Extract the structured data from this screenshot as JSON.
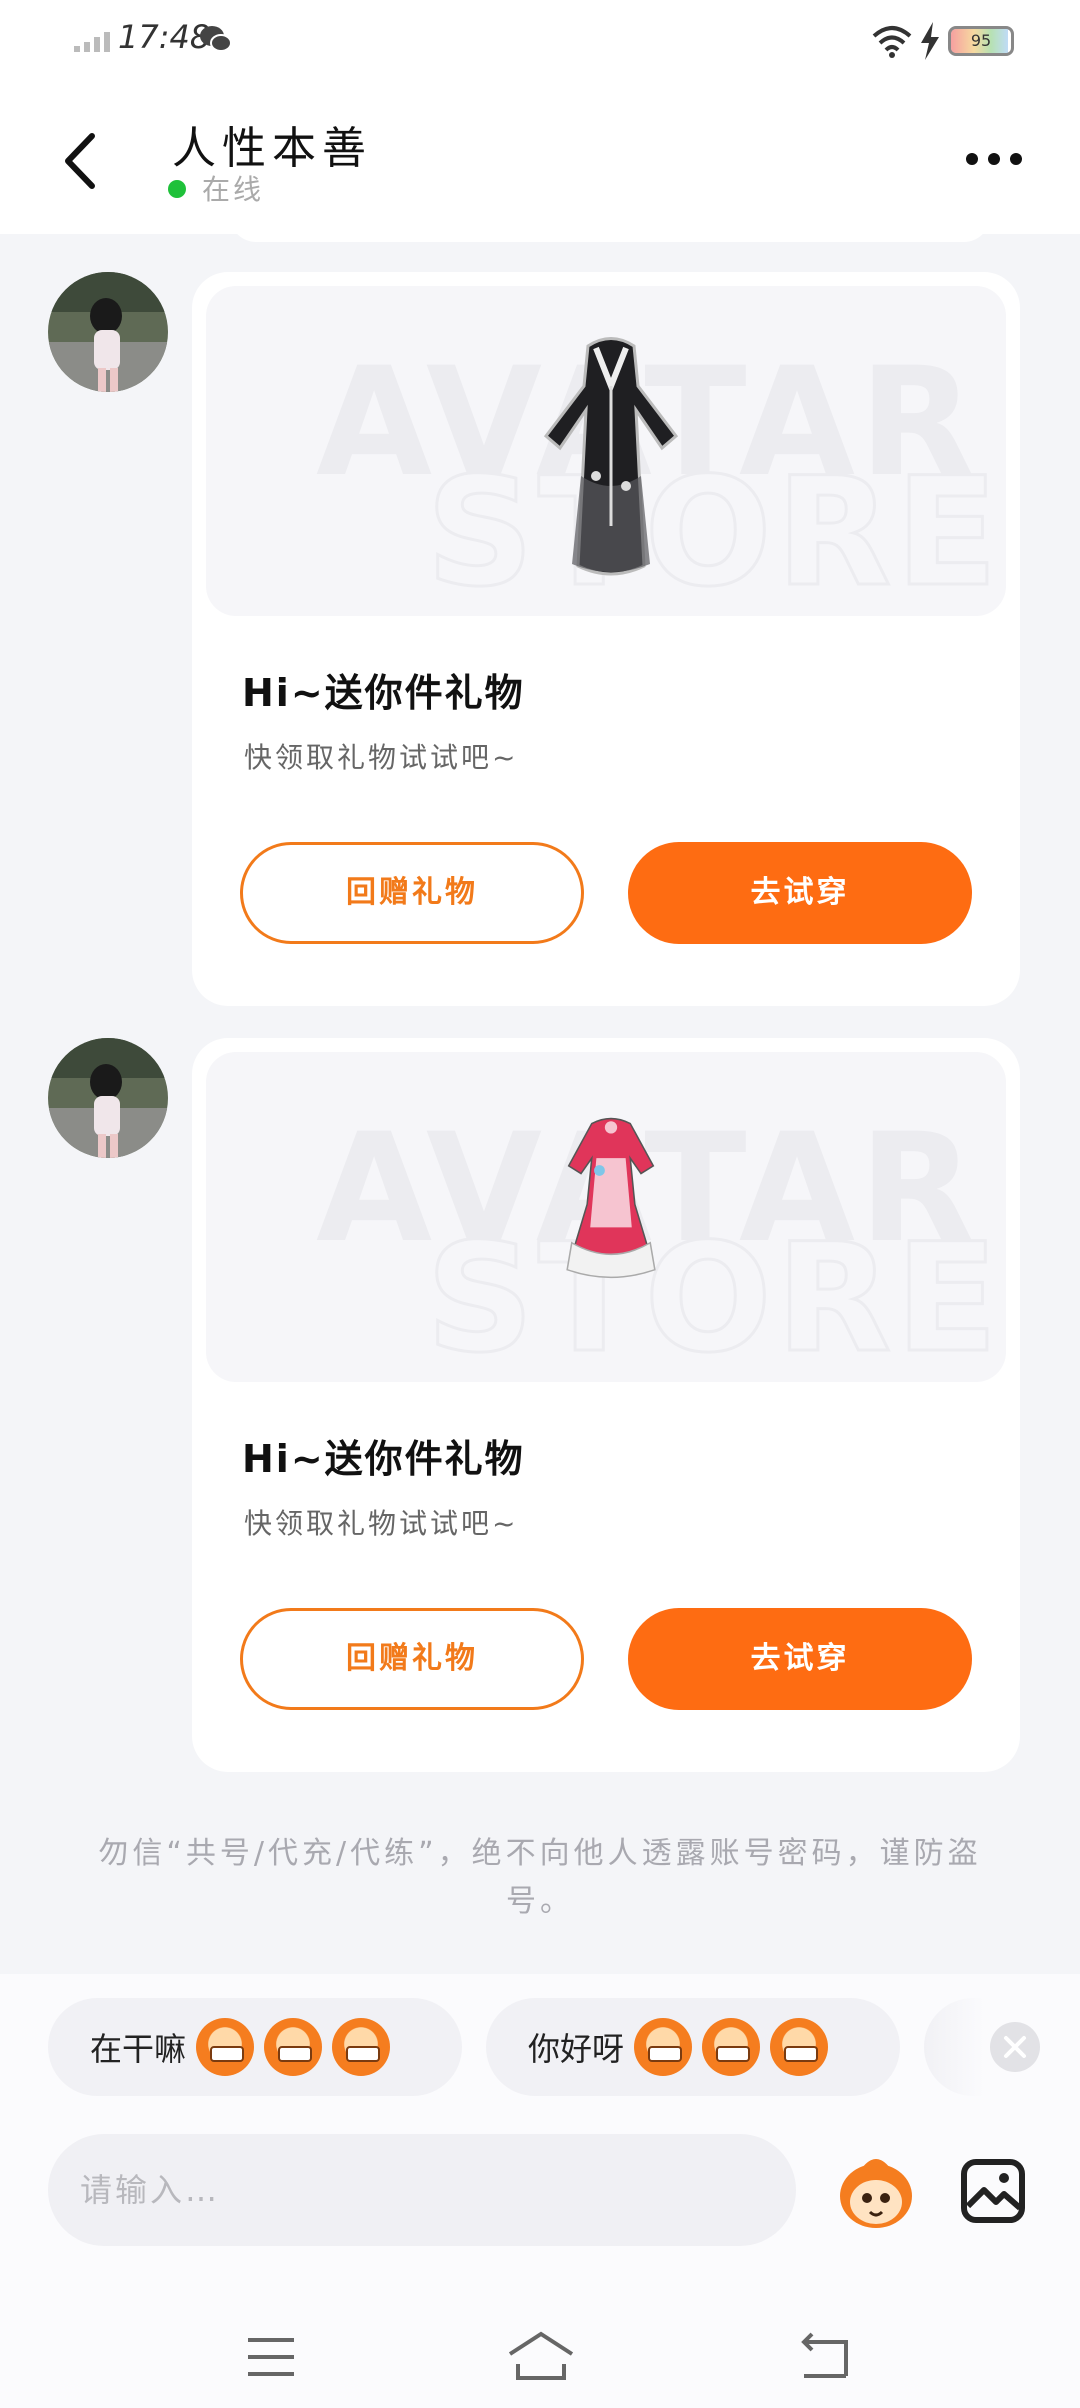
{
  "status_bar": {
    "time": "17:48",
    "battery_level": "95",
    "icons": [
      "signal-icon",
      "wechat-icon",
      "wifi-icon",
      "charging-icon",
      "battery-icon"
    ]
  },
  "header": {
    "title": "人性本善",
    "status": "在线",
    "status_color": "#1fc13a"
  },
  "messages": [
    {
      "title": "Hi~送你件礼物",
      "subtitle": "快领取礼物试试吧~",
      "secondary_button": "回赠礼物",
      "primary_button": "去试穿",
      "item": "black-lace-dress"
    },
    {
      "title": "Hi~送你件礼物",
      "subtitle": "快领取礼物试试吧~",
      "secondary_button": "回赠礼物",
      "primary_button": "去试穿",
      "item": "pink-maid-dress"
    }
  ],
  "notice": "勿信“共号/代充/代练”，绝不向他人透露账号密码，谨防盗号。",
  "quick_replies": [
    {
      "label": "在干嘛",
      "emoji_count": 3
    },
    {
      "label": "你好呀",
      "emoji_count": 3
    }
  ],
  "input": {
    "placeholder": "请输入…"
  },
  "colors": {
    "accent": "#fe6c12",
    "outline": "#f27a1a",
    "background": "#f4f5f8"
  }
}
